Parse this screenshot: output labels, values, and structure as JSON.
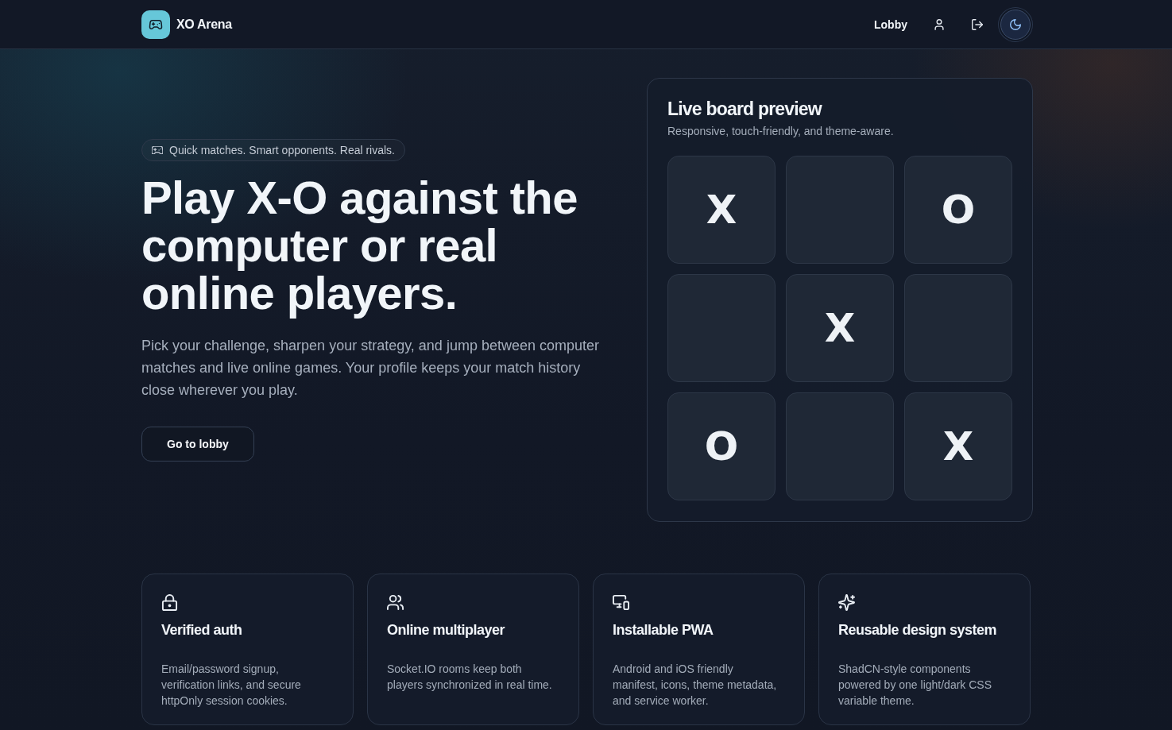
{
  "header": {
    "brand": "XO Arena",
    "nav_link": "Lobby"
  },
  "hero": {
    "badge": "Quick matches. Smart opponents. Real rivals.",
    "title": "Play X-O against the computer or real online players.",
    "description": "Pick your challenge, sharpen your strategy, and jump between computer matches and live online games. Your profile keeps your match history close wherever you play.",
    "button": "Go to lobby"
  },
  "preview": {
    "title": "Live board preview",
    "subtitle": "Responsive, touch-friendly, and theme-aware.",
    "cells": [
      {
        "kind": "mark",
        "mark": "X"
      },
      {
        "kind": "empty"
      },
      {
        "kind": "mark",
        "mark": "O"
      },
      {
        "kind": "empty"
      },
      {
        "kind": "mark",
        "mark": "X"
      },
      {
        "kind": "empty"
      },
      {
        "kind": "mark",
        "mark": "O"
      },
      {
        "kind": "empty"
      },
      {
        "kind": "mark",
        "mark": "X"
      }
    ]
  },
  "features": [
    {
      "title": "Verified auth",
      "description": "Email/password signup, verification links, and secure httpOnly session cookies."
    },
    {
      "title": "Online multiplayer",
      "description": "Socket.IO rooms keep both players synchronized in real time."
    },
    {
      "title": "Installable PWA",
      "description": "Android and iOS friendly manifest, icons, theme metadata, and service worker."
    },
    {
      "title": "Reusable design system",
      "description": "ShadCN-style components powered by one light/dark CSS variable theme."
    }
  ]
}
